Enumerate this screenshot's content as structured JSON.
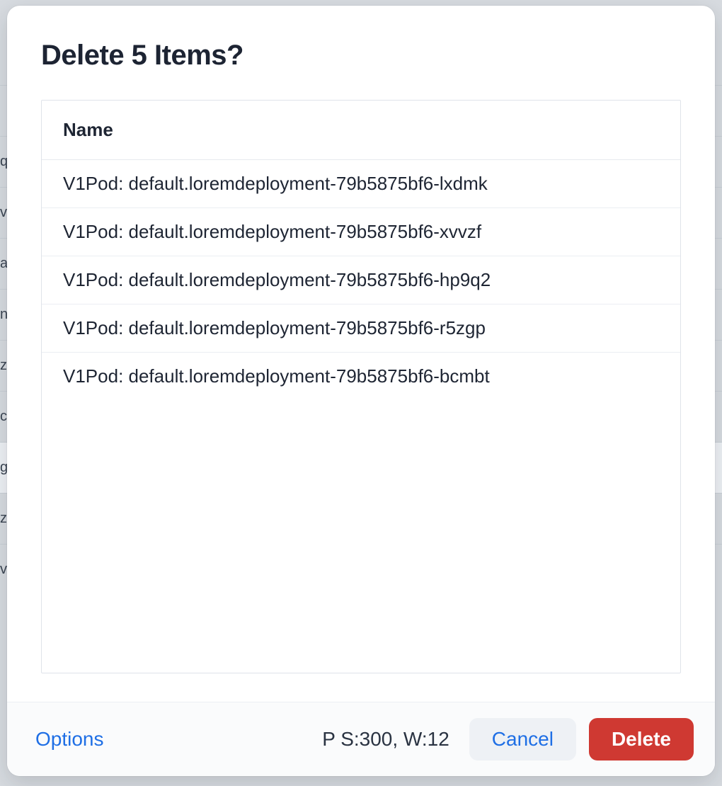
{
  "modal": {
    "title": "Delete 5 Items?",
    "list_header": "Name",
    "items": [
      "V1Pod: default.loremdeployment-79b5875bf6-lxdmk",
      "V1Pod: default.loremdeployment-79b5875bf6-xvvzf",
      "V1Pod: default.loremdeployment-79b5875bf6-hp9q2",
      "V1Pod: default.loremdeployment-79b5875bf6-r5zgp",
      "V1Pod: default.loremdeployment-79b5875bf6-bcmbt"
    ]
  },
  "footer": {
    "options_label": "Options",
    "status": "P S:300, W:12",
    "cancel_label": "Cancel",
    "delete_label": "Delete"
  },
  "background_rows": [
    "",
    "q:",
    "v",
    "al",
    "n",
    "z",
    "c",
    "g",
    "z",
    "v"
  ]
}
